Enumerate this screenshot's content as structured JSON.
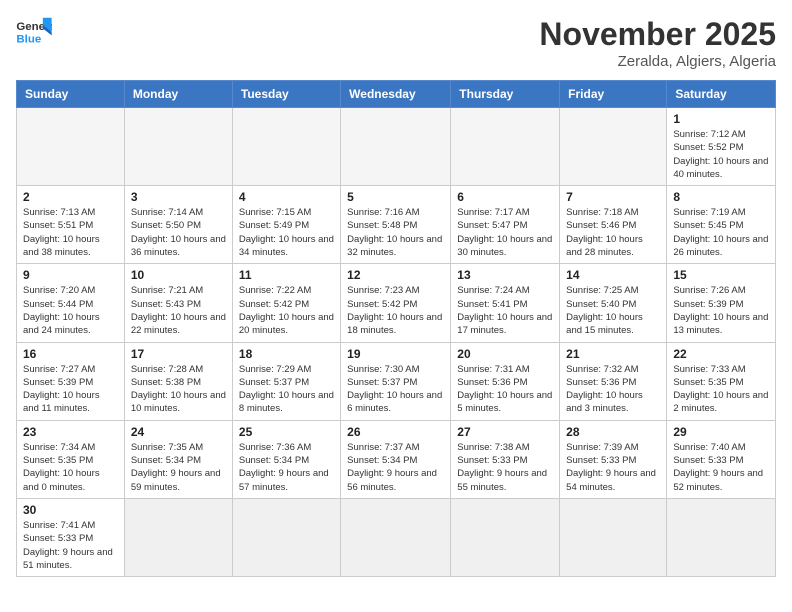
{
  "header": {
    "logo_general": "General",
    "logo_blue": "Blue",
    "month_title": "November 2025",
    "location": "Zeralda, Algiers, Algeria"
  },
  "weekdays": [
    "Sunday",
    "Monday",
    "Tuesday",
    "Wednesday",
    "Thursday",
    "Friday",
    "Saturday"
  ],
  "weeks": [
    [
      {
        "day": "",
        "info": ""
      },
      {
        "day": "",
        "info": ""
      },
      {
        "day": "",
        "info": ""
      },
      {
        "day": "",
        "info": ""
      },
      {
        "day": "",
        "info": ""
      },
      {
        "day": "",
        "info": ""
      },
      {
        "day": "1",
        "info": "Sunrise: 7:12 AM\nSunset: 5:52 PM\nDaylight: 10 hours and 40 minutes."
      }
    ],
    [
      {
        "day": "2",
        "info": "Sunrise: 7:13 AM\nSunset: 5:51 PM\nDaylight: 10 hours and 38 minutes."
      },
      {
        "day": "3",
        "info": "Sunrise: 7:14 AM\nSunset: 5:50 PM\nDaylight: 10 hours and 36 minutes."
      },
      {
        "day": "4",
        "info": "Sunrise: 7:15 AM\nSunset: 5:49 PM\nDaylight: 10 hours and 34 minutes."
      },
      {
        "day": "5",
        "info": "Sunrise: 7:16 AM\nSunset: 5:48 PM\nDaylight: 10 hours and 32 minutes."
      },
      {
        "day": "6",
        "info": "Sunrise: 7:17 AM\nSunset: 5:47 PM\nDaylight: 10 hours and 30 minutes."
      },
      {
        "day": "7",
        "info": "Sunrise: 7:18 AM\nSunset: 5:46 PM\nDaylight: 10 hours and 28 minutes."
      },
      {
        "day": "8",
        "info": "Sunrise: 7:19 AM\nSunset: 5:45 PM\nDaylight: 10 hours and 26 minutes."
      }
    ],
    [
      {
        "day": "9",
        "info": "Sunrise: 7:20 AM\nSunset: 5:44 PM\nDaylight: 10 hours and 24 minutes."
      },
      {
        "day": "10",
        "info": "Sunrise: 7:21 AM\nSunset: 5:43 PM\nDaylight: 10 hours and 22 minutes."
      },
      {
        "day": "11",
        "info": "Sunrise: 7:22 AM\nSunset: 5:42 PM\nDaylight: 10 hours and 20 minutes."
      },
      {
        "day": "12",
        "info": "Sunrise: 7:23 AM\nSunset: 5:42 PM\nDaylight: 10 hours and 18 minutes."
      },
      {
        "day": "13",
        "info": "Sunrise: 7:24 AM\nSunset: 5:41 PM\nDaylight: 10 hours and 17 minutes."
      },
      {
        "day": "14",
        "info": "Sunrise: 7:25 AM\nSunset: 5:40 PM\nDaylight: 10 hours and 15 minutes."
      },
      {
        "day": "15",
        "info": "Sunrise: 7:26 AM\nSunset: 5:39 PM\nDaylight: 10 hours and 13 minutes."
      }
    ],
    [
      {
        "day": "16",
        "info": "Sunrise: 7:27 AM\nSunset: 5:39 PM\nDaylight: 10 hours and 11 minutes."
      },
      {
        "day": "17",
        "info": "Sunrise: 7:28 AM\nSunset: 5:38 PM\nDaylight: 10 hours and 10 minutes."
      },
      {
        "day": "18",
        "info": "Sunrise: 7:29 AM\nSunset: 5:37 PM\nDaylight: 10 hours and 8 minutes."
      },
      {
        "day": "19",
        "info": "Sunrise: 7:30 AM\nSunset: 5:37 PM\nDaylight: 10 hours and 6 minutes."
      },
      {
        "day": "20",
        "info": "Sunrise: 7:31 AM\nSunset: 5:36 PM\nDaylight: 10 hours and 5 minutes."
      },
      {
        "day": "21",
        "info": "Sunrise: 7:32 AM\nSunset: 5:36 PM\nDaylight: 10 hours and 3 minutes."
      },
      {
        "day": "22",
        "info": "Sunrise: 7:33 AM\nSunset: 5:35 PM\nDaylight: 10 hours and 2 minutes."
      }
    ],
    [
      {
        "day": "23",
        "info": "Sunrise: 7:34 AM\nSunset: 5:35 PM\nDaylight: 10 hours and 0 minutes."
      },
      {
        "day": "24",
        "info": "Sunrise: 7:35 AM\nSunset: 5:34 PM\nDaylight: 9 hours and 59 minutes."
      },
      {
        "day": "25",
        "info": "Sunrise: 7:36 AM\nSunset: 5:34 PM\nDaylight: 9 hours and 57 minutes."
      },
      {
        "day": "26",
        "info": "Sunrise: 7:37 AM\nSunset: 5:34 PM\nDaylight: 9 hours and 56 minutes."
      },
      {
        "day": "27",
        "info": "Sunrise: 7:38 AM\nSunset: 5:33 PM\nDaylight: 9 hours and 55 minutes."
      },
      {
        "day": "28",
        "info": "Sunrise: 7:39 AM\nSunset: 5:33 PM\nDaylight: 9 hours and 54 minutes."
      },
      {
        "day": "29",
        "info": "Sunrise: 7:40 AM\nSunset: 5:33 PM\nDaylight: 9 hours and 52 minutes."
      }
    ],
    [
      {
        "day": "30",
        "info": "Sunrise: 7:41 AM\nSunset: 5:33 PM\nDaylight: 9 hours and 51 minutes."
      },
      {
        "day": "",
        "info": ""
      },
      {
        "day": "",
        "info": ""
      },
      {
        "day": "",
        "info": ""
      },
      {
        "day": "",
        "info": ""
      },
      {
        "day": "",
        "info": ""
      },
      {
        "day": "",
        "info": ""
      }
    ]
  ]
}
